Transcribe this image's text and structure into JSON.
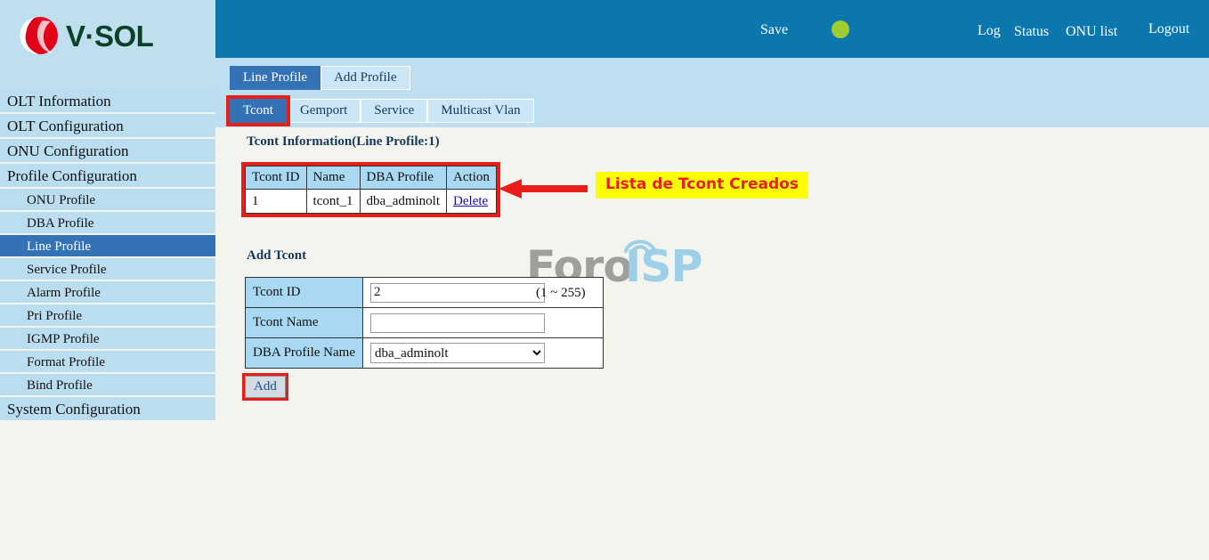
{
  "brand": {
    "logo_text": "V·SOL",
    "logo_icon": "vsol-swirl-icon",
    "brand_green": "#0a4228",
    "brand_red": "#e2001a"
  },
  "header": {
    "bar_color": "#0b77ac",
    "save_label": "Save",
    "status_indicator_color": "#9ecc33",
    "nav": {
      "log": "Log",
      "status": "Status",
      "onu_list": "ONU list",
      "logout": "Logout"
    }
  },
  "sidebar": {
    "items": [
      {
        "label": "OLT Information",
        "sub": false,
        "active": false
      },
      {
        "label": "OLT Configuration",
        "sub": false,
        "active": false
      },
      {
        "label": "ONU Configuration",
        "sub": false,
        "active": false
      },
      {
        "label": "Profile Configuration",
        "sub": false,
        "active": false
      },
      {
        "label": "ONU Profile",
        "sub": true,
        "active": false
      },
      {
        "label": "DBA Profile",
        "sub": true,
        "active": false
      },
      {
        "label": "Line Profile",
        "sub": true,
        "active": true
      },
      {
        "label": "Service Profile",
        "sub": true,
        "active": false
      },
      {
        "label": "Alarm Profile",
        "sub": true,
        "active": false
      },
      {
        "label": "Pri Profile",
        "sub": true,
        "active": false
      },
      {
        "label": "IGMP Profile",
        "sub": true,
        "active": false
      },
      {
        "label": "Format Profile",
        "sub": true,
        "active": false
      },
      {
        "label": "Bind Profile",
        "sub": true,
        "active": false
      },
      {
        "label": "System Configuration",
        "sub": false,
        "active": false
      }
    ]
  },
  "tabs": {
    "primary": [
      {
        "label": "Line Profile",
        "active": true
      },
      {
        "label": "Add Profile",
        "active": false
      }
    ],
    "secondary": [
      {
        "label": "Tcont",
        "active": true,
        "highlight": true
      },
      {
        "label": "Gemport",
        "active": false,
        "highlight": false
      },
      {
        "label": "Service",
        "active": false,
        "highlight": false
      },
      {
        "label": "Multicast Vlan",
        "active": false,
        "highlight": false
      }
    ]
  },
  "tcont_info": {
    "title": "Tcont Information(Line Profile:1)",
    "columns": [
      "Tcont ID",
      "Name",
      "DBA Profile",
      "Action"
    ],
    "rows": [
      {
        "id": "1",
        "name": "tcont_1",
        "dba_profile": "dba_adminolt",
        "action": "Delete"
      }
    ]
  },
  "annotation": {
    "text": "Lista de Tcont Creados",
    "box_color": "#ffff00",
    "text_color": "#e81f18",
    "arrow_color": "#e81f18",
    "arrow_direction": "left"
  },
  "add_tcont": {
    "title": "Add Tcont",
    "fields": {
      "tcont_id": {
        "label": "Tcont ID",
        "value": "2",
        "placeholder": "",
        "hint": "(1 ~ 255)"
      },
      "tcont_name": {
        "label": "Tcont Name",
        "value": "",
        "placeholder": ""
      },
      "dba_profile_name": {
        "label": "DBA Profile Name",
        "selected": "dba_adminolt",
        "options": [
          "dba_adminolt"
        ]
      }
    },
    "add_button": "Add"
  },
  "watermark": {
    "part1": "Foro",
    "part2": "ISP",
    "part1_color": "#8d8d8d",
    "part2_color": "#9ecfe8"
  }
}
